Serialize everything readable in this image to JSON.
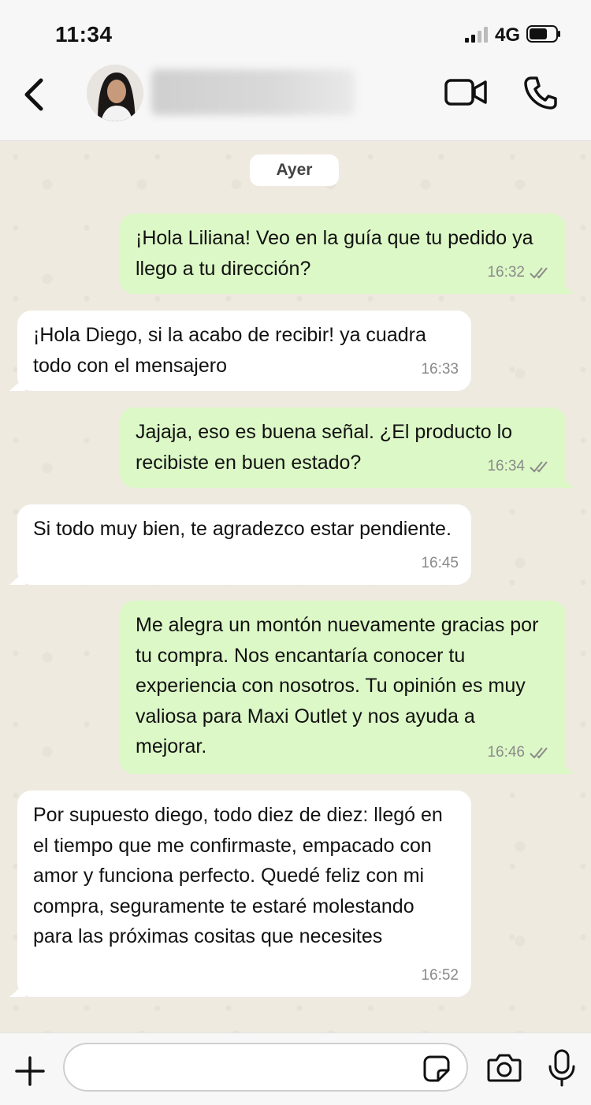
{
  "status_bar": {
    "time": "11:34",
    "network": "4G"
  },
  "header": {
    "contact_name": ""
  },
  "chat": {
    "day_label": "Ayer",
    "messages": [
      {
        "direction": "out",
        "text": "¡Hola Liliana! Veo en la guía que tu pedido ya llego a tu dirección?",
        "time": "16:32",
        "read": true
      },
      {
        "direction": "in",
        "text": "¡Hola Diego, si la acabo de recibir! ya cuadra todo con el mensajero",
        "time": "16:33"
      },
      {
        "direction": "out",
        "text": "Jajaja, eso es buena señal. ¿El producto lo recibiste en buen estado?",
        "time": "16:34",
        "read": true
      },
      {
        "direction": "in",
        "text": "Si todo muy bien, te agradezco estar pendiente.",
        "time": "16:45"
      },
      {
        "direction": "out",
        "text": "Me alegra un montón nuevamente gracias por tu compra. Nos encantaría conocer tu experiencia con nosotros. Tu opinión es muy valiosa para Maxi Outlet y nos ayuda a mejorar.",
        "time": "16:46",
        "read": true
      },
      {
        "direction": "in",
        "text": "Por supuesto diego, todo diez de diez: llegó en el tiempo que me confirmaste, empacado con amor y funciona perfecto. Quedé feliz con mi compra, seguramente te estaré molestando para las próximas cositas que necesites",
        "time": "16:52"
      }
    ]
  },
  "input_bar": {
    "placeholder": ""
  },
  "colors": {
    "outgoing_bubble": "#dcf8c6",
    "incoming_bubble": "#ffffff",
    "chat_background": "#efeae0",
    "read_ticks": "#8a8a8a"
  },
  "icons": {
    "back": "chevron-left-icon",
    "video": "video-camera-icon",
    "call": "phone-icon",
    "attach": "plus-icon",
    "sticker": "sticker-icon",
    "camera": "camera-icon",
    "mic": "microphone-icon"
  }
}
